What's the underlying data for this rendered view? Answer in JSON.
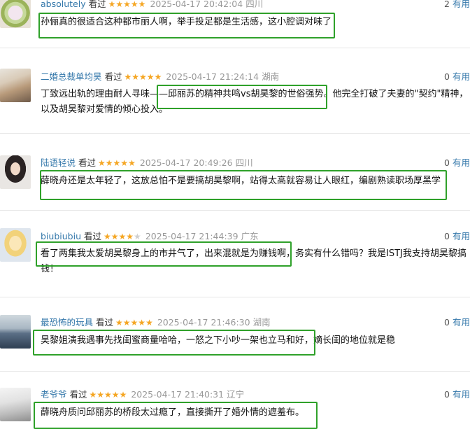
{
  "reviews": [
    {
      "user": "absolutely",
      "watched": "看过",
      "stars": "★★★★★",
      "stars_off": "",
      "date": "2025-04-17 20:42:04",
      "location": "四川",
      "useful_count": "2",
      "useful_label": "有用",
      "content": "孙俪真的很适合这种都市丽人啊，举手投足都是生活感，这小腔调对味了"
    },
    {
      "user": "二婚总裁单均昊",
      "watched": "看过",
      "stars": "★★★★★",
      "stars_off": "",
      "date": "2025-04-17 21:24:14",
      "location": "湖南",
      "useful_count": "0",
      "useful_label": "有用",
      "content": "丁致远出轨的理由耐人寻味——邱丽苏的精神共鸣vs胡昊黎的世俗强势。他完全打破了夫妻的\"契约\"精神，以及胡昊黎对爱情的倾心投入。"
    },
    {
      "user": "陆语轻说",
      "watched": "看过",
      "stars": "★★★★★",
      "stars_off": "",
      "date": "2025-04-17 20:49:26",
      "location": "四川",
      "useful_count": "0",
      "useful_label": "有用",
      "content": "薛晓舟还是太年轻了，这放总怕不是要搞胡昊黎啊，站得太高就容易让人眼红，编剧熟读职场厚黑学"
    },
    {
      "user": "biubiubiu",
      "watched": "看过",
      "stars": "★★★★",
      "stars_off": "★",
      "date": "2025-04-17 21:44:39",
      "location": "广东",
      "useful_count": "0",
      "useful_label": "有用",
      "content": "看了两集我太爱胡昊黎身上的市井气了，出来混就是为赚钱啊，务实有什么错吗？我是ISTJ我支持胡昊黎搞钱！"
    },
    {
      "user": "最恐怖的玩具",
      "watched": "看过",
      "stars": "★★★★★",
      "stars_off": "",
      "date": "2025-04-17 21:46:30",
      "location": "湖南",
      "useful_count": "0",
      "useful_label": "有用",
      "content": "昊黎姐演我遇事先找闺蜜商量哈哈，一怒之下小吵一架也立马和好，嫡长闺的地位就是稳"
    },
    {
      "user": "老爷爷",
      "watched": "看过",
      "stars": "★★★★★",
      "stars_off": "",
      "date": "2025-04-17 21:40:31",
      "location": "辽宁",
      "useful_count": "0",
      "useful_label": "有用",
      "content": "薛晓舟质问邱丽苏的桥段太过瘾了，直接撕开了婚外情的遮羞布。"
    }
  ],
  "colors": {
    "username": "#3377aa",
    "stars": "#f5a623",
    "highlight_box": "#2fa12a",
    "meta_gray": "#999999"
  }
}
